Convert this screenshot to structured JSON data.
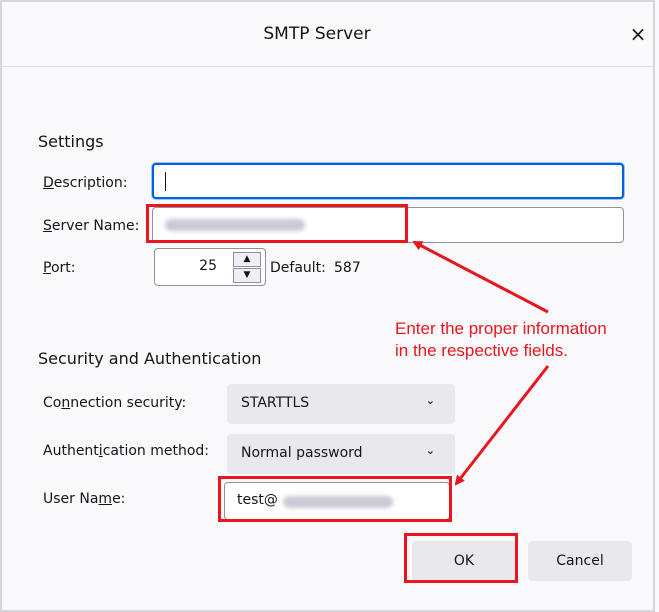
{
  "dialog": {
    "title": "SMTP Server",
    "close_icon": "×"
  },
  "settings": {
    "heading": "Settings",
    "description": {
      "label_accel": "D",
      "label_rest": "escription:",
      "value": ""
    },
    "server_name": {
      "label_accel": "S",
      "label_rest": "erver Name:"
    },
    "port": {
      "label_accel": "P",
      "label_rest": "ort:",
      "value": "25",
      "up_icon": "▲",
      "down_icon": "▼",
      "default_label": "Default:",
      "default_value": "587"
    }
  },
  "security": {
    "heading": "Security and Authentication",
    "connection_security": {
      "label_pre": "Co",
      "label_accel": "n",
      "label_post": "nection security:",
      "value": "STARTTLS"
    },
    "auth_method": {
      "label_pre": "Authent",
      "label_accel": "i",
      "label_post": "cation method:",
      "value": "Normal password"
    },
    "user_name": {
      "label_pre": "User Na",
      "label_accel": "m",
      "label_post": "e:",
      "value_visible": "test@"
    },
    "chevron_icon": "⌄"
  },
  "buttons": {
    "ok": "OK",
    "cancel": "Cancel"
  },
  "annotation": {
    "line1": "Enter the proper information",
    "line2": "in the respective fields.",
    "color": "#e8161f"
  }
}
